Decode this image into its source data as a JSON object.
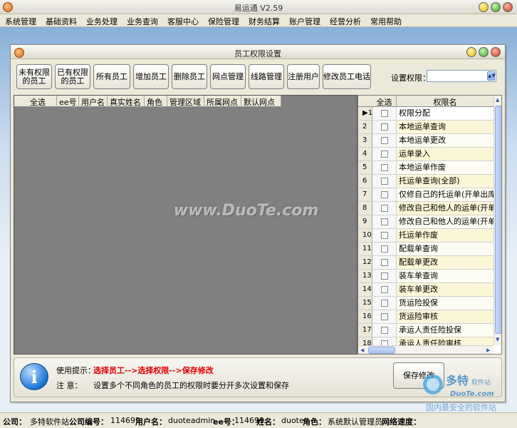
{
  "app": {
    "title": "易运通 V2.59"
  },
  "menu": [
    "系统管理",
    "基础资料",
    "业务处理",
    "业务查询",
    "客服中心",
    "保险管理",
    "财务结算",
    "账户管理",
    "经营分析",
    "常用帮助"
  ],
  "dialog": {
    "title": "员工权限设置",
    "toolbar": [
      {
        "line1": "未有权限",
        "line2": "的员工"
      },
      {
        "line1": "已有权限",
        "line2": "的员工"
      },
      {
        "line1": "所有员工",
        "line2": ""
      },
      {
        "line1": "增加员工",
        "line2": ""
      },
      {
        "line1": "删除员工",
        "line2": ""
      },
      {
        "line1": "网点管理",
        "line2": ""
      },
      {
        "line1": "线路管理",
        "line2": ""
      },
      {
        "line1": "注册用户",
        "line2": ""
      },
      {
        "line1": "修改员工电话",
        "line2": ""
      }
    ],
    "permission_select": {
      "label": "设置权限：",
      "value": ""
    },
    "employee_table": {
      "columns": [
        "全选",
        "ee号",
        "用户名",
        "真实姓名",
        "角色",
        "管理区域",
        "所属网点",
        "默认网点"
      ]
    },
    "permission_grid": {
      "columns": [
        "全选",
        "权限名"
      ],
      "current_row_marker": "▶1",
      "rows": [
        {
          "idx": "1",
          "name": "权限分配"
        },
        {
          "idx": "2",
          "name": "本地运单查询"
        },
        {
          "idx": "3",
          "name": "本地运单更改"
        },
        {
          "idx": "4",
          "name": "运单录入"
        },
        {
          "idx": "5",
          "name": "本地运单作废"
        },
        {
          "idx": "6",
          "name": "托运单查询(全部)"
        },
        {
          "idx": "7",
          "name": "仅修自己的托运单(开单出库前"
        },
        {
          "idx": "8",
          "name": "修改自己和他人的运单(开单出"
        },
        {
          "idx": "9",
          "name": "修改自己和他人的运单(开单出"
        },
        {
          "idx": "10",
          "name": "托运单作废"
        },
        {
          "idx": "11",
          "name": "配载单查询"
        },
        {
          "idx": "12",
          "name": "配载单更改"
        },
        {
          "idx": "13",
          "name": "装车单查询"
        },
        {
          "idx": "14",
          "name": "装车单更改"
        },
        {
          "idx": "15",
          "name": "货运险投保"
        },
        {
          "idx": "16",
          "name": "货运险审核"
        },
        {
          "idx": "17",
          "name": "承运人责任险投保"
        },
        {
          "idx": "18",
          "name": "承运人责任险审核"
        }
      ]
    },
    "hint": {
      "label1": "使用提示：",
      "text1": "选择员工-->选择权限-->保存修改",
      "label2": "注    意：",
      "text2": "设置多个不同角色的员工的权限时要分开多次设置和保存"
    },
    "save_label": "保存修改"
  },
  "watermark": "www.DuoTe.com",
  "corner_mark": {
    "line1": "多特软件站",
    "line2": "DuoTe.com",
    "line3": "国内最安全的软件站"
  },
  "status": {
    "company_label": "公司：",
    "company": "多特软件站",
    "company_no_label": "公司编号：",
    "company_no": "114699",
    "user_label": "用户名：",
    "user": "duoteadmin",
    "ee_label": "ee号：",
    "ee": "114699",
    "name_label": "姓名：",
    "name": "duote",
    "role_label": "角色：",
    "role": "系统默认管理员",
    "speed_label": "网络速度：",
    "speed": ""
  }
}
